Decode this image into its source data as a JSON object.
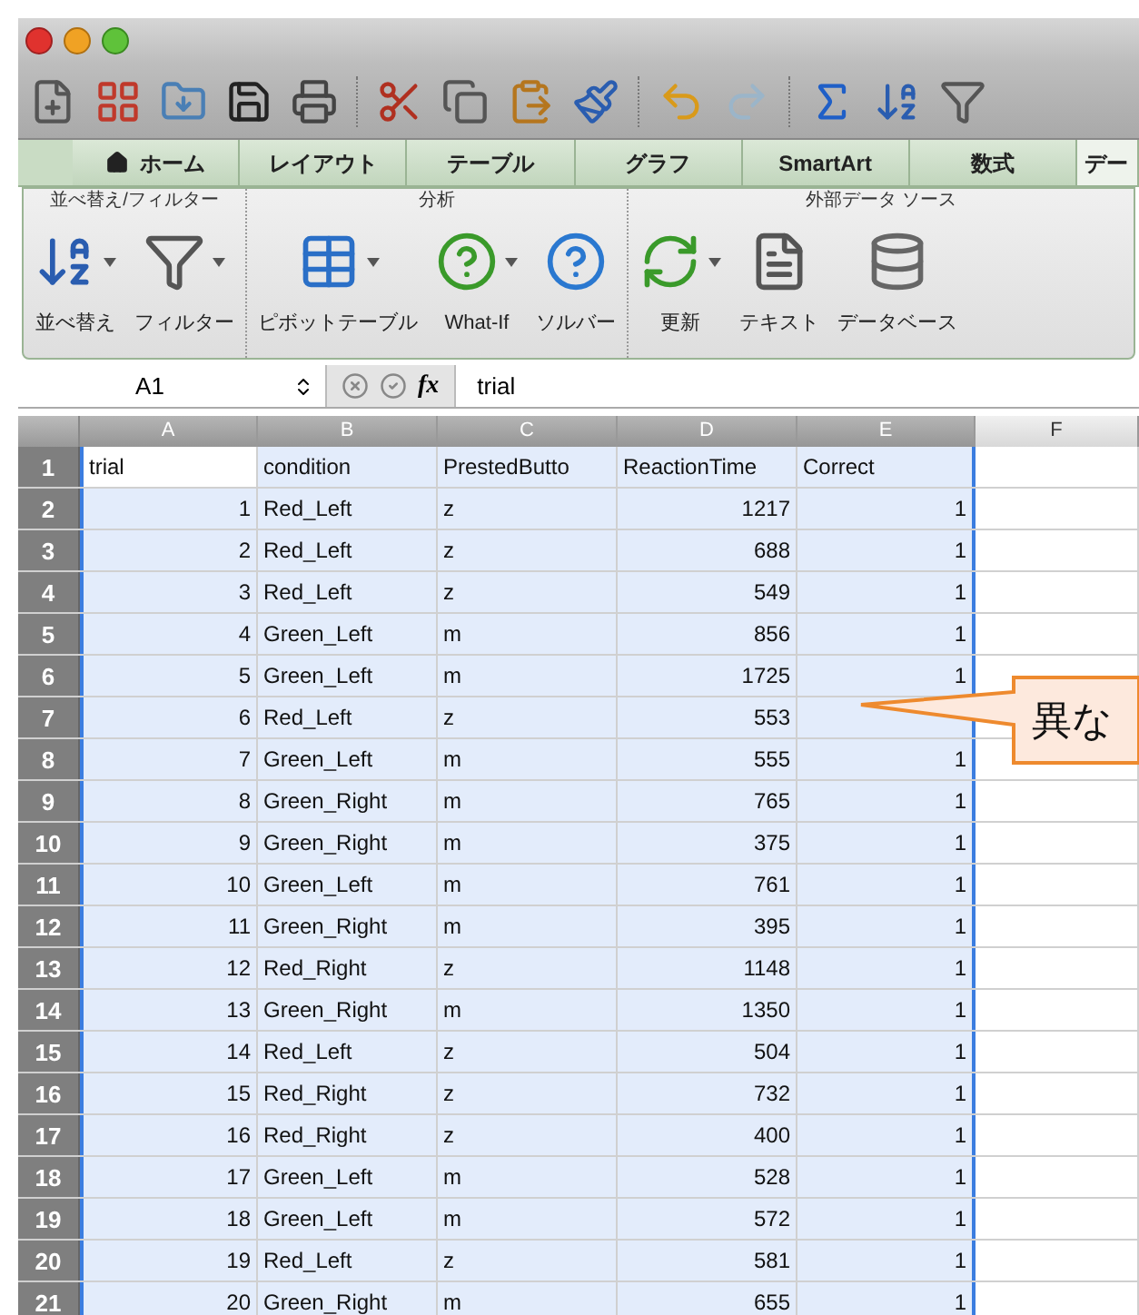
{
  "toolbar": {
    "items": [
      {
        "kind": "new"
      },
      {
        "kind": "gallery"
      },
      {
        "kind": "open"
      },
      {
        "kind": "save"
      },
      {
        "kind": "print"
      },
      {
        "kind": "sep"
      },
      {
        "kind": "cut"
      },
      {
        "kind": "copy"
      },
      {
        "kind": "paste"
      },
      {
        "kind": "format"
      },
      {
        "kind": "sep"
      },
      {
        "kind": "undo"
      },
      {
        "kind": "redo"
      },
      {
        "kind": "sep"
      },
      {
        "kind": "sum"
      },
      {
        "kind": "sort"
      },
      {
        "kind": "filter"
      }
    ]
  },
  "tabs": [
    {
      "label": "ホーム",
      "kind": "home",
      "selected": false
    },
    {
      "label": "レイアウト",
      "selected": false
    },
    {
      "label": "テーブル",
      "selected": false
    },
    {
      "label": "グラフ",
      "selected": false
    },
    {
      "label": "SmartArt",
      "selected": false
    },
    {
      "label": "数式",
      "selected": false
    },
    {
      "label": "デー",
      "selected": true
    }
  ],
  "ribbon": {
    "groups": [
      {
        "title": "並べ替え/フィルター",
        "buttons": [
          {
            "label": "並べ替え",
            "kind": "sort",
            "dropdown": true
          },
          {
            "label": "フィルター",
            "kind": "filter",
            "dropdown": true
          }
        ]
      },
      {
        "title": "分析",
        "buttons": [
          {
            "label": "ピボットテーブル",
            "kind": "pivot",
            "dropdown": true
          },
          {
            "label": "What-If",
            "kind": "whatif",
            "dropdown": true
          },
          {
            "label": "ソルバー",
            "kind": "solver",
            "dropdown": false
          }
        ]
      },
      {
        "title": "外部データ ソース",
        "buttons": [
          {
            "label": "更新",
            "kind": "refresh",
            "dropdown": true
          },
          {
            "label": "テキスト",
            "kind": "text",
            "dropdown": false
          },
          {
            "label": "データベース",
            "kind": "database",
            "dropdown": false
          }
        ]
      }
    ]
  },
  "formula_bar": {
    "name_box": "A1",
    "function_label": "fx",
    "value": "trial"
  },
  "sheet": {
    "columns": [
      {
        "label": "A",
        "selected": true,
        "kind": "number"
      },
      {
        "label": "B",
        "selected": true,
        "kind": "text"
      },
      {
        "label": "C",
        "selected": true,
        "kind": "text"
      },
      {
        "label": "D",
        "selected": true,
        "kind": "number"
      },
      {
        "label": "E",
        "selected": true,
        "kind": "number"
      },
      {
        "label": "F",
        "selected": false,
        "kind": "text"
      }
    ],
    "rows": [
      {
        "number": "1",
        "kind": "header",
        "active": true,
        "selected": true,
        "cells": [
          "trial",
          "condition",
          "PrestedButto",
          "ReactionTime",
          "Correct"
        ]
      },
      {
        "number": "2",
        "kind": "data",
        "active": false,
        "selected": true,
        "cells": [
          "1",
          "Red_Left",
          "z",
          "1217",
          "1"
        ]
      },
      {
        "number": "3",
        "kind": "data",
        "active": false,
        "selected": true,
        "cells": [
          "2",
          "Red_Left",
          "z",
          "688",
          "1"
        ]
      },
      {
        "number": "4",
        "kind": "data",
        "active": false,
        "selected": true,
        "cells": [
          "3",
          "Red_Left",
          "z",
          "549",
          "1"
        ]
      },
      {
        "number": "5",
        "kind": "data",
        "active": false,
        "selected": true,
        "cells": [
          "4",
          "Green_Left",
          "m",
          "856",
          "1"
        ]
      },
      {
        "number": "6",
        "kind": "data",
        "active": false,
        "selected": true,
        "cells": [
          "5",
          "Green_Left",
          "m",
          "1725",
          "1"
        ]
      },
      {
        "number": "7",
        "kind": "data",
        "active": false,
        "selected": true,
        "cells": [
          "6",
          "Red_Left",
          "z",
          "553"
        ]
      },
      {
        "number": "8",
        "kind": "data",
        "active": false,
        "selected": true,
        "cells": [
          "7",
          "Green_Left",
          "m",
          "555",
          "1"
        ]
      },
      {
        "number": "9",
        "kind": "data",
        "active": false,
        "selected": true,
        "cells": [
          "8",
          "Green_Right",
          "m",
          "765",
          "1"
        ]
      },
      {
        "number": "10",
        "kind": "data",
        "active": false,
        "selected": true,
        "cells": [
          "9",
          "Green_Right",
          "m",
          "375",
          "1"
        ]
      },
      {
        "number": "11",
        "kind": "data",
        "active": false,
        "selected": true,
        "cells": [
          "10",
          "Green_Left",
          "m",
          "761",
          "1"
        ]
      },
      {
        "number": "12",
        "kind": "data",
        "active": false,
        "selected": true,
        "cells": [
          "11",
          "Green_Right",
          "m",
          "395",
          "1"
        ]
      },
      {
        "number": "13",
        "kind": "data",
        "active": false,
        "selected": true,
        "cells": [
          "12",
          "Red_Right",
          "z",
          "1148",
          "1"
        ]
      },
      {
        "number": "14",
        "kind": "data",
        "active": false,
        "selected": true,
        "cells": [
          "13",
          "Green_Right",
          "m",
          "1350",
          "1"
        ]
      },
      {
        "number": "15",
        "kind": "data",
        "active": false,
        "selected": true,
        "cells": [
          "14",
          "Red_Left",
          "z",
          "504",
          "1"
        ]
      },
      {
        "number": "16",
        "kind": "data",
        "active": false,
        "selected": true,
        "cells": [
          "15",
          "Red_Right",
          "z",
          "732",
          "1"
        ]
      },
      {
        "number": "17",
        "kind": "data",
        "active": false,
        "selected": true,
        "cells": [
          "16",
          "Red_Right",
          "z",
          "400",
          "1"
        ]
      },
      {
        "number": "18",
        "kind": "data",
        "active": false,
        "selected": true,
        "cells": [
          "17",
          "Green_Left",
          "m",
          "528",
          "1"
        ]
      },
      {
        "number": "19",
        "kind": "data",
        "active": false,
        "selected": true,
        "cells": [
          "18",
          "Green_Left",
          "m",
          "572",
          "1"
        ]
      },
      {
        "number": "20",
        "kind": "data",
        "active": false,
        "selected": true,
        "cells": [
          "19",
          "Red_Left",
          "z",
          "581",
          "1"
        ]
      },
      {
        "number": "21",
        "kind": "data",
        "active": false,
        "selected": true,
        "cells": [
          "20",
          "Green_Right",
          "m",
          "655",
          "1"
        ]
      }
    ]
  },
  "callout": {
    "text": "異な"
  }
}
